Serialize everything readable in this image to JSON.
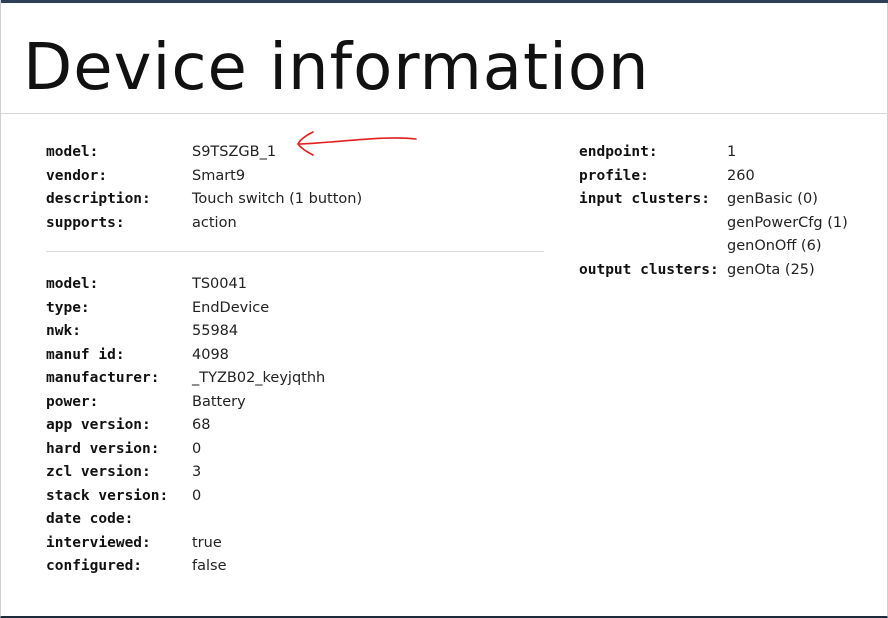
{
  "title": "Device information",
  "device_summary": [
    {
      "label": "model:",
      "value": "S9TSZGB_1"
    },
    {
      "label": "vendor:",
      "value": "Smart9"
    },
    {
      "label": "description:",
      "value": "Touch switch (1 button)"
    },
    {
      "label": "supports:",
      "value": "action"
    }
  ],
  "device_details": [
    {
      "label": "model:",
      "value": "TS0041"
    },
    {
      "label": "type:",
      "value": "EndDevice"
    },
    {
      "label": "nwk:",
      "value": "55984"
    },
    {
      "label": "manuf id:",
      "value": "4098"
    },
    {
      "label": "manufacturer:",
      "value": "_TYZB02_keyjqthh"
    },
    {
      "label": "power:",
      "value": "Battery"
    },
    {
      "label": "app version:",
      "value": "68"
    },
    {
      "label": "hard version:",
      "value": "0"
    },
    {
      "label": "zcl version:",
      "value": "3"
    },
    {
      "label": "stack version:",
      "value": "0"
    },
    {
      "label": "date code:",
      "value": ""
    },
    {
      "label": "interviewed:",
      "value": "true"
    },
    {
      "label": "configured:",
      "value": "false"
    }
  ],
  "endpoint_info": [
    {
      "label": "endpoint:",
      "value": "1"
    },
    {
      "label": "profile:",
      "value": "260"
    },
    {
      "label": "input clusters:",
      "value": "genBasic (0)"
    },
    {
      "label": "",
      "value": "genPowerCfg (1)"
    },
    {
      "label": "",
      "value": "genOnOff (6)"
    },
    {
      "label": "output clusters:",
      "value": "genOta (25)"
    }
  ],
  "colors": {
    "annotation_arrow": "#e0201c",
    "top_border": "#2e4057"
  }
}
